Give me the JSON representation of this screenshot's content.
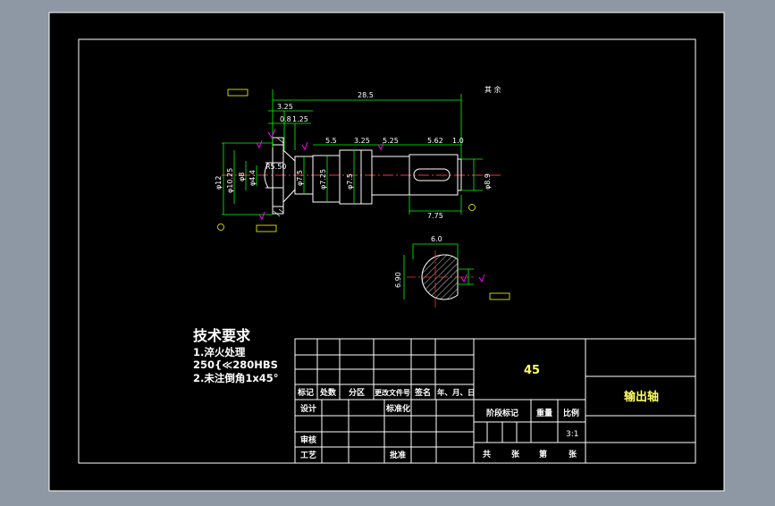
{
  "colors": {
    "app_bg": "#8e97a4",
    "paper": "#000000",
    "line": "#ffffff",
    "dimension": "#00ff00",
    "leader": "#00ffff",
    "marker": "#ff00ff",
    "text": "#ffffff",
    "hatch": "#ffffff"
  },
  "dimensions": {
    "total_length": "28.5",
    "d_3_25a": "3.25",
    "d_0_8": "0.8",
    "d_1_25": "1.25",
    "d_5_5": "5.5",
    "d_3_25b": "3.25",
    "d_5_25": "5.25",
    "d_5_62": "5.62",
    "d_1_0": "1.0",
    "d_7_75": "7.75",
    "dia_12": "φ12",
    "dia_10_25": "φ10.25",
    "dia_8": "φ8",
    "dia_4_4": "φ4.4",
    "r_5_50": "R5.50",
    "dia_7_5a": "φ7.5",
    "dia_7_25": "φ7.25",
    "dia_7_5b": "φ7.5",
    "dia_8_9": "φ8.9",
    "key_width": "6.0",
    "key_depth": "6.90",
    "roughness_note": "其 余"
  },
  "tech_req": {
    "title": "技术要求",
    "line1": "1.淬火处理",
    "line2": "250{≪280HBS",
    "line3": "2.未注倒角1x45°"
  },
  "title_block": {
    "material": "45",
    "part_name": "输出轴",
    "row_labels": [
      "标记",
      "处数",
      "分区",
      "更改文件号",
      "签名",
      "年、月、日"
    ],
    "design": "设计",
    "standard": "标准化",
    "review": "审核",
    "process": "工艺",
    "approve": "批准",
    "stage_mark": "阶段标记",
    "weight": "重量",
    "scale_label": "比例",
    "scale_value": "3:1",
    "sheets_total": "共",
    "sheets_unit": "张",
    "sheet_no": "第",
    "sheet_unit2": "张"
  }
}
